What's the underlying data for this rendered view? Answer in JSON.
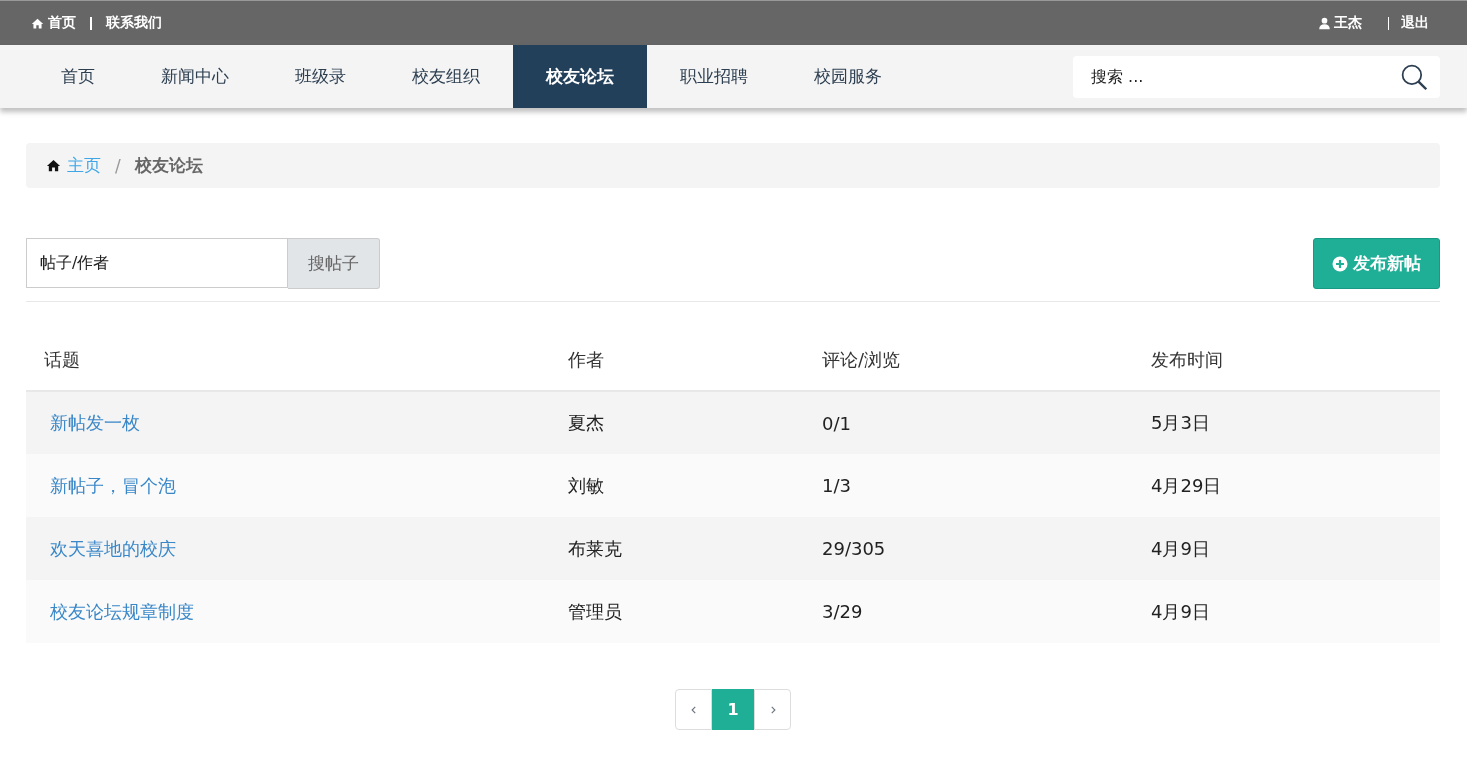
{
  "top_bar": {
    "links": [
      {
        "label": "首页",
        "kind": "home"
      },
      {
        "label": "联系我们",
        "kind": "plain"
      }
    ],
    "user": {
      "name": "王杰",
      "logout": "退出"
    }
  },
  "nav": {
    "items": [
      {
        "label": "首页",
        "selected": false
      },
      {
        "label": "新闻中心",
        "selected": false
      },
      {
        "label": "班级录",
        "selected": false
      },
      {
        "label": "校友组织",
        "selected": false
      },
      {
        "label": "校友论坛",
        "selected": true
      },
      {
        "label": "职业招聘",
        "selected": false
      },
      {
        "label": "校园服务",
        "selected": false
      }
    ],
    "search": {
      "placeholder": "搜索 ..."
    }
  },
  "breadcrumb": {
    "home": "主页",
    "separator": "/",
    "current": "校友论坛"
  },
  "toolbar": {
    "search": {
      "value": "帖子/作者"
    },
    "search_button": "搜帖子",
    "new_post_button": "发布新帖"
  },
  "table": {
    "columns": [
      "话题",
      "作者",
      "评论/浏览",
      "发布时间"
    ],
    "rows": [
      [
        "新帖发一枚",
        "夏杰",
        "0/1",
        "5月3日"
      ],
      [
        "新帖子，冒个泡",
        "刘敏",
        "1/3",
        "4月29日"
      ],
      [
        "欢天喜地的校庆",
        "布莱克",
        "29/305",
        "4月9日"
      ],
      [
        "校友论坛规章制度",
        "管理员",
        "3/29",
        "4月9日"
      ]
    ]
  },
  "pagination": {
    "pages": [
      {
        "label": "1",
        "selected": true
      }
    ]
  }
}
